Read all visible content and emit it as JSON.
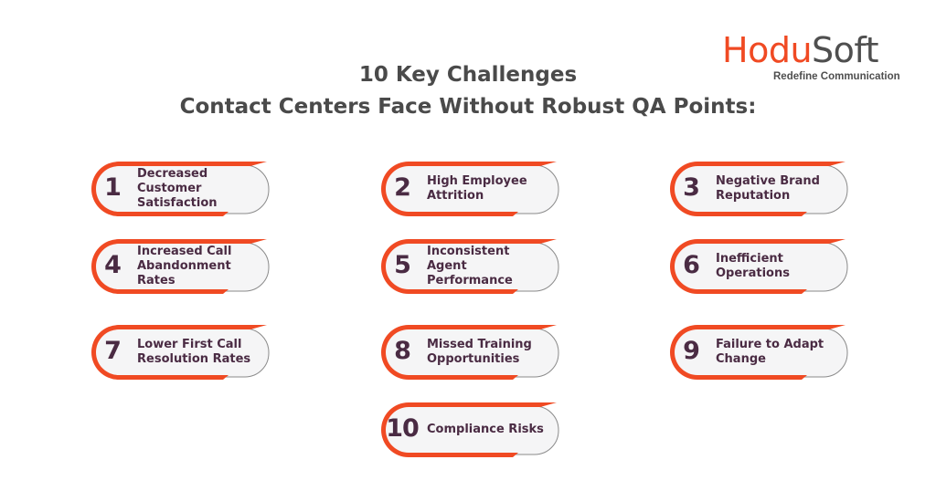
{
  "brand": {
    "name_part1": "Hodu",
    "name_part2": "Soft",
    "tagline": "Redefine Communication",
    "colors": {
      "accent": "#f04a23",
      "dark": "#4f4f4f",
      "text": "#4a2b43",
      "card_bg": "#f5f5f6"
    }
  },
  "title": {
    "line1": "10 Key Challenges",
    "line2": "Contact Centers Face Without Robust QA Points:"
  },
  "challenges": [
    {
      "number": "1",
      "label": "Decreased Customer Satisfaction"
    },
    {
      "number": "2",
      "label": "High Employee Attrition"
    },
    {
      "number": "3",
      "label": "Negative Brand Reputation"
    },
    {
      "number": "4",
      "label": "Increased Call Abandonment Rates"
    },
    {
      "number": "5",
      "label": "Inconsistent Agent Performance"
    },
    {
      "number": "6",
      "label": "Inefficient Operations"
    },
    {
      "number": "7",
      "label": "Lower First Call Resolution Rates"
    },
    {
      "number": "8",
      "label": "Missed Training Opportunities"
    },
    {
      "number": "9",
      "label": "Failure to Adapt Change"
    },
    {
      "number": "10",
      "label": "Compliance Risks"
    }
  ]
}
